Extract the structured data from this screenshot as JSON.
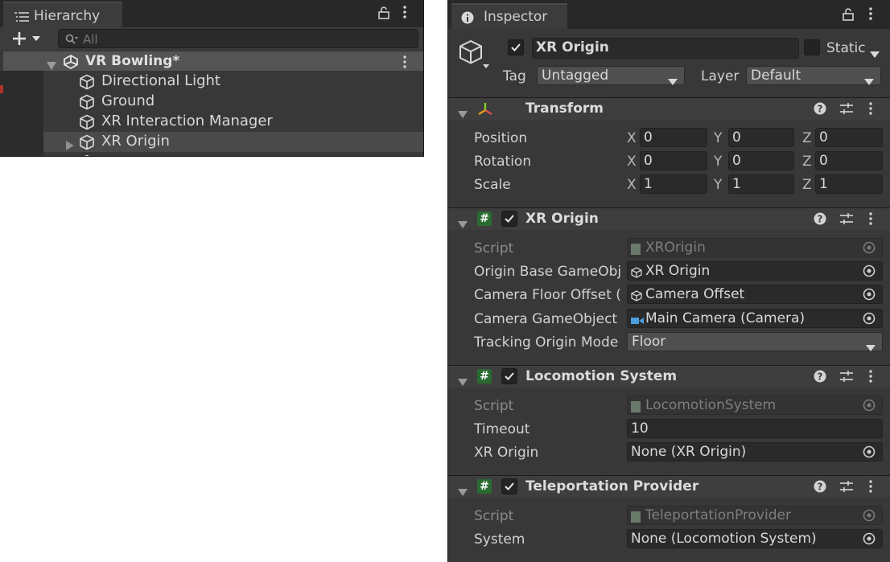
{
  "hierarchy": {
    "tab_title": "Hierarchy",
    "search_placeholder": "All",
    "scene_name": "VR Bowling*",
    "items": [
      {
        "label": "Directional Light"
      },
      {
        "label": "Ground"
      },
      {
        "label": "XR Interaction Manager"
      },
      {
        "label": "XR Origin"
      }
    ]
  },
  "inspector": {
    "tab_title": "Inspector",
    "object_name": "XR Origin",
    "static_label": "Static",
    "tag_label": "Tag",
    "tag_value": "Untagged",
    "layer_label": "Layer",
    "layer_value": "Default",
    "transform": {
      "title": "Transform",
      "position_label": "Position",
      "rotation_label": "Rotation",
      "scale_label": "Scale",
      "axis_x": "X",
      "axis_y": "Y",
      "axis_z": "Z",
      "position": {
        "x": "0",
        "y": "0",
        "z": "0"
      },
      "rotation": {
        "x": "0",
        "y": "0",
        "z": "0"
      },
      "scale": {
        "x": "1",
        "y": "1",
        "z": "1"
      }
    },
    "xr_origin": {
      "title": "XR Origin",
      "script_label": "Script",
      "script_value": "XROrigin",
      "origin_base_label": "Origin Base GameObj",
      "origin_base_value": "XR Origin",
      "camera_floor_label": "Camera Floor Offset (",
      "camera_floor_value": "Camera Offset",
      "camera_go_label": "Camera GameObject",
      "camera_go_value": "Main Camera (Camera)",
      "tracking_label": "Tracking Origin Mode",
      "tracking_value": "Floor"
    },
    "locomotion": {
      "title": "Locomotion System",
      "script_label": "Script",
      "script_value": "LocomotionSystem",
      "timeout_label": "Timeout",
      "timeout_value": "10",
      "xr_origin_label": "XR Origin",
      "xr_origin_value": "None (XR Origin)"
    },
    "teleport": {
      "title": "Teleportation Provider",
      "script_label": "Script",
      "script_value": "TeleportationProvider",
      "system_label": "System",
      "system_value": "None (Locomotion System)"
    }
  },
  "colors": {
    "panel_bg": "#383838",
    "field_bg": "#2a2a2a",
    "script_icon": "#2a6b32",
    "camera_icon": "#4aa0e0"
  }
}
